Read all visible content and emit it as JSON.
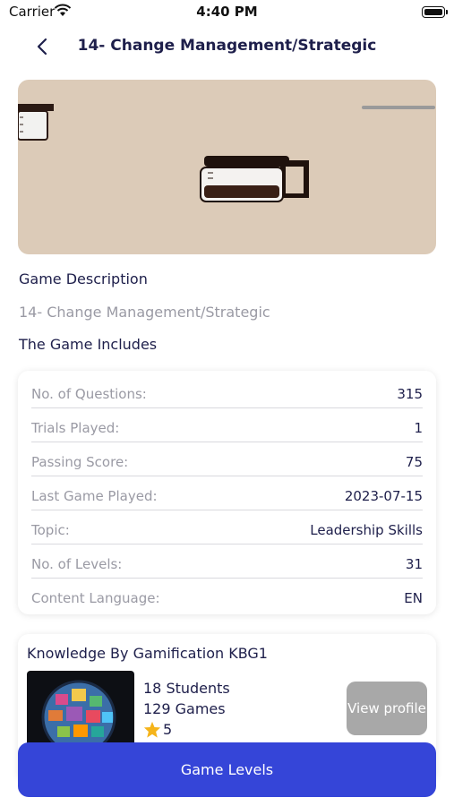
{
  "status_bar": {
    "carrier": "Carrier",
    "time": "4:40 PM"
  },
  "nav": {
    "title": "14- Change Management/Strategic"
  },
  "hero": {
    "background_color": "#dccbb8"
  },
  "description": {
    "heading": "Game Description",
    "text": "14- Change Management/Strategic"
  },
  "includes": {
    "heading": "The Game Includes",
    "rows": [
      {
        "label": "No. of Questions:",
        "value": "315"
      },
      {
        "label": "Trials Played:",
        "value": "1"
      },
      {
        "label": "Passing Score:",
        "value": "75"
      },
      {
        "label": "Last Game Played:",
        "value": "2023-07-15"
      },
      {
        "label": "Topic:",
        "value": "Leadership Skills"
      },
      {
        "label": "No. of Levels:",
        "value": "31"
      },
      {
        "label": "Content Language:",
        "value": "EN"
      }
    ]
  },
  "creator": {
    "name": "Knowledge By Gamification KBG1",
    "students": "18 Students",
    "games": "129 Games",
    "rating": "5",
    "view_profile_label": "View profile"
  },
  "game_levels_label": "Game Levels",
  "colors": {
    "primary": "#3545d8",
    "text_dark": "#1e1f4b",
    "text_muted": "#9a9aa4",
    "star": "#f5b41a"
  }
}
